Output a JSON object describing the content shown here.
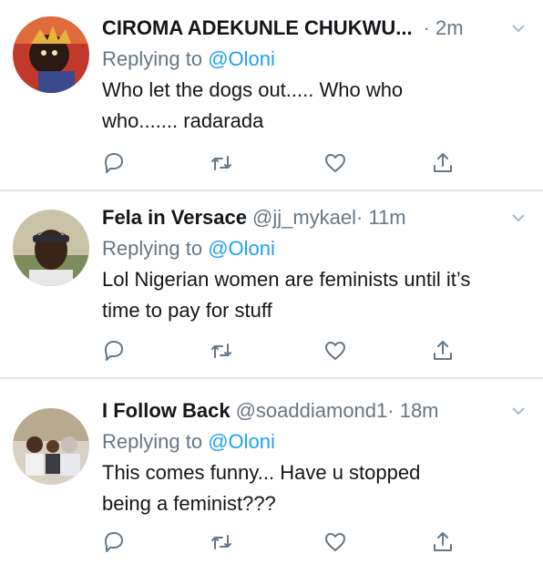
{
  "tweets": [
    {
      "name": "CIROMA ADEKUNLE CHUKWU...",
      "handle": "",
      "time": "· 2m",
      "replying_prefix": "Replying to ",
      "replying_to": "@Oloni",
      "text_lines": [
        "Who let the dogs out..... Who who",
        "who....... radarada"
      ]
    },
    {
      "name": "Fela in Versace",
      "handle": "@jj_mykael",
      "time": "· 11m",
      "replying_prefix": "Replying to ",
      "replying_to": "@Oloni",
      "text_lines": [
        "Lol Nigerian women are feminists until it’s",
        "time to pay for stuff"
      ]
    },
    {
      "name": "I Follow Back",
      "handle": "@soaddiamond1",
      "time": "· 18m",
      "replying_prefix": "Replying to ",
      "replying_to": "@Oloni",
      "text_lines": [
        "This comes funny... Have u stopped",
        "being a feminist???"
      ]
    }
  ],
  "icons": {
    "reply": "reply-icon",
    "retweet": "retweet-icon",
    "like": "heart-icon",
    "share": "share-icon",
    "caret": "chevron-down-icon"
  },
  "colors": {
    "secondary_text": "#657786",
    "mention": "#1da1f2",
    "icon": "#657786",
    "divider": "#e3e6e8"
  }
}
